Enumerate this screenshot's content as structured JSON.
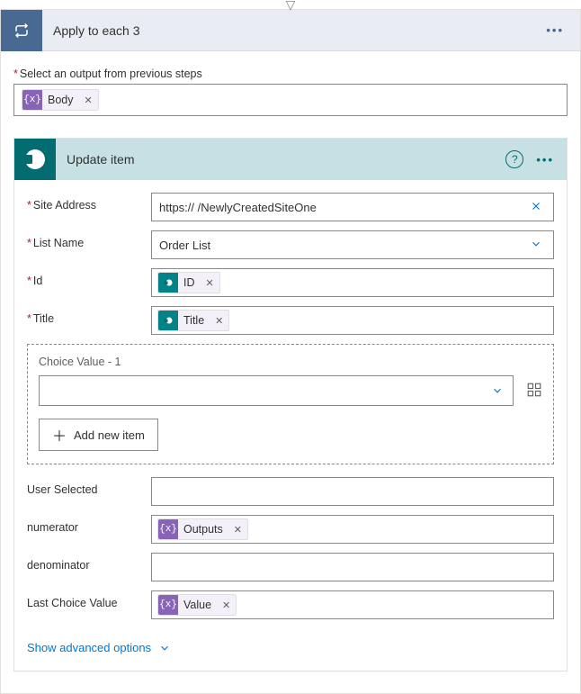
{
  "arrow_marker": "▽",
  "outer": {
    "title": "Apply to each 3",
    "field_label": "Select an output from previous steps",
    "body_token": "Body"
  },
  "inner": {
    "title": "Update item",
    "fields": {
      "site_address": {
        "label": "Site Address",
        "value": "https://                                                  /NewlyCreatedSiteOne"
      },
      "list_name": {
        "label": "List Name",
        "value": "Order List"
      },
      "id": {
        "label": "Id",
        "token": "ID"
      },
      "title": {
        "label": "Title",
        "token": "Title"
      },
      "choice_section": {
        "title": "Choice Value - 1",
        "add_button": "Add new item"
      },
      "user_selected": {
        "label": "User Selected"
      },
      "numerator": {
        "label": "numerator",
        "token": "Outputs"
      },
      "denominator": {
        "label": "denominator"
      },
      "last_choice": {
        "label": "Last Choice Value",
        "token": "Value"
      }
    },
    "advanced_link": "Show advanced options"
  }
}
